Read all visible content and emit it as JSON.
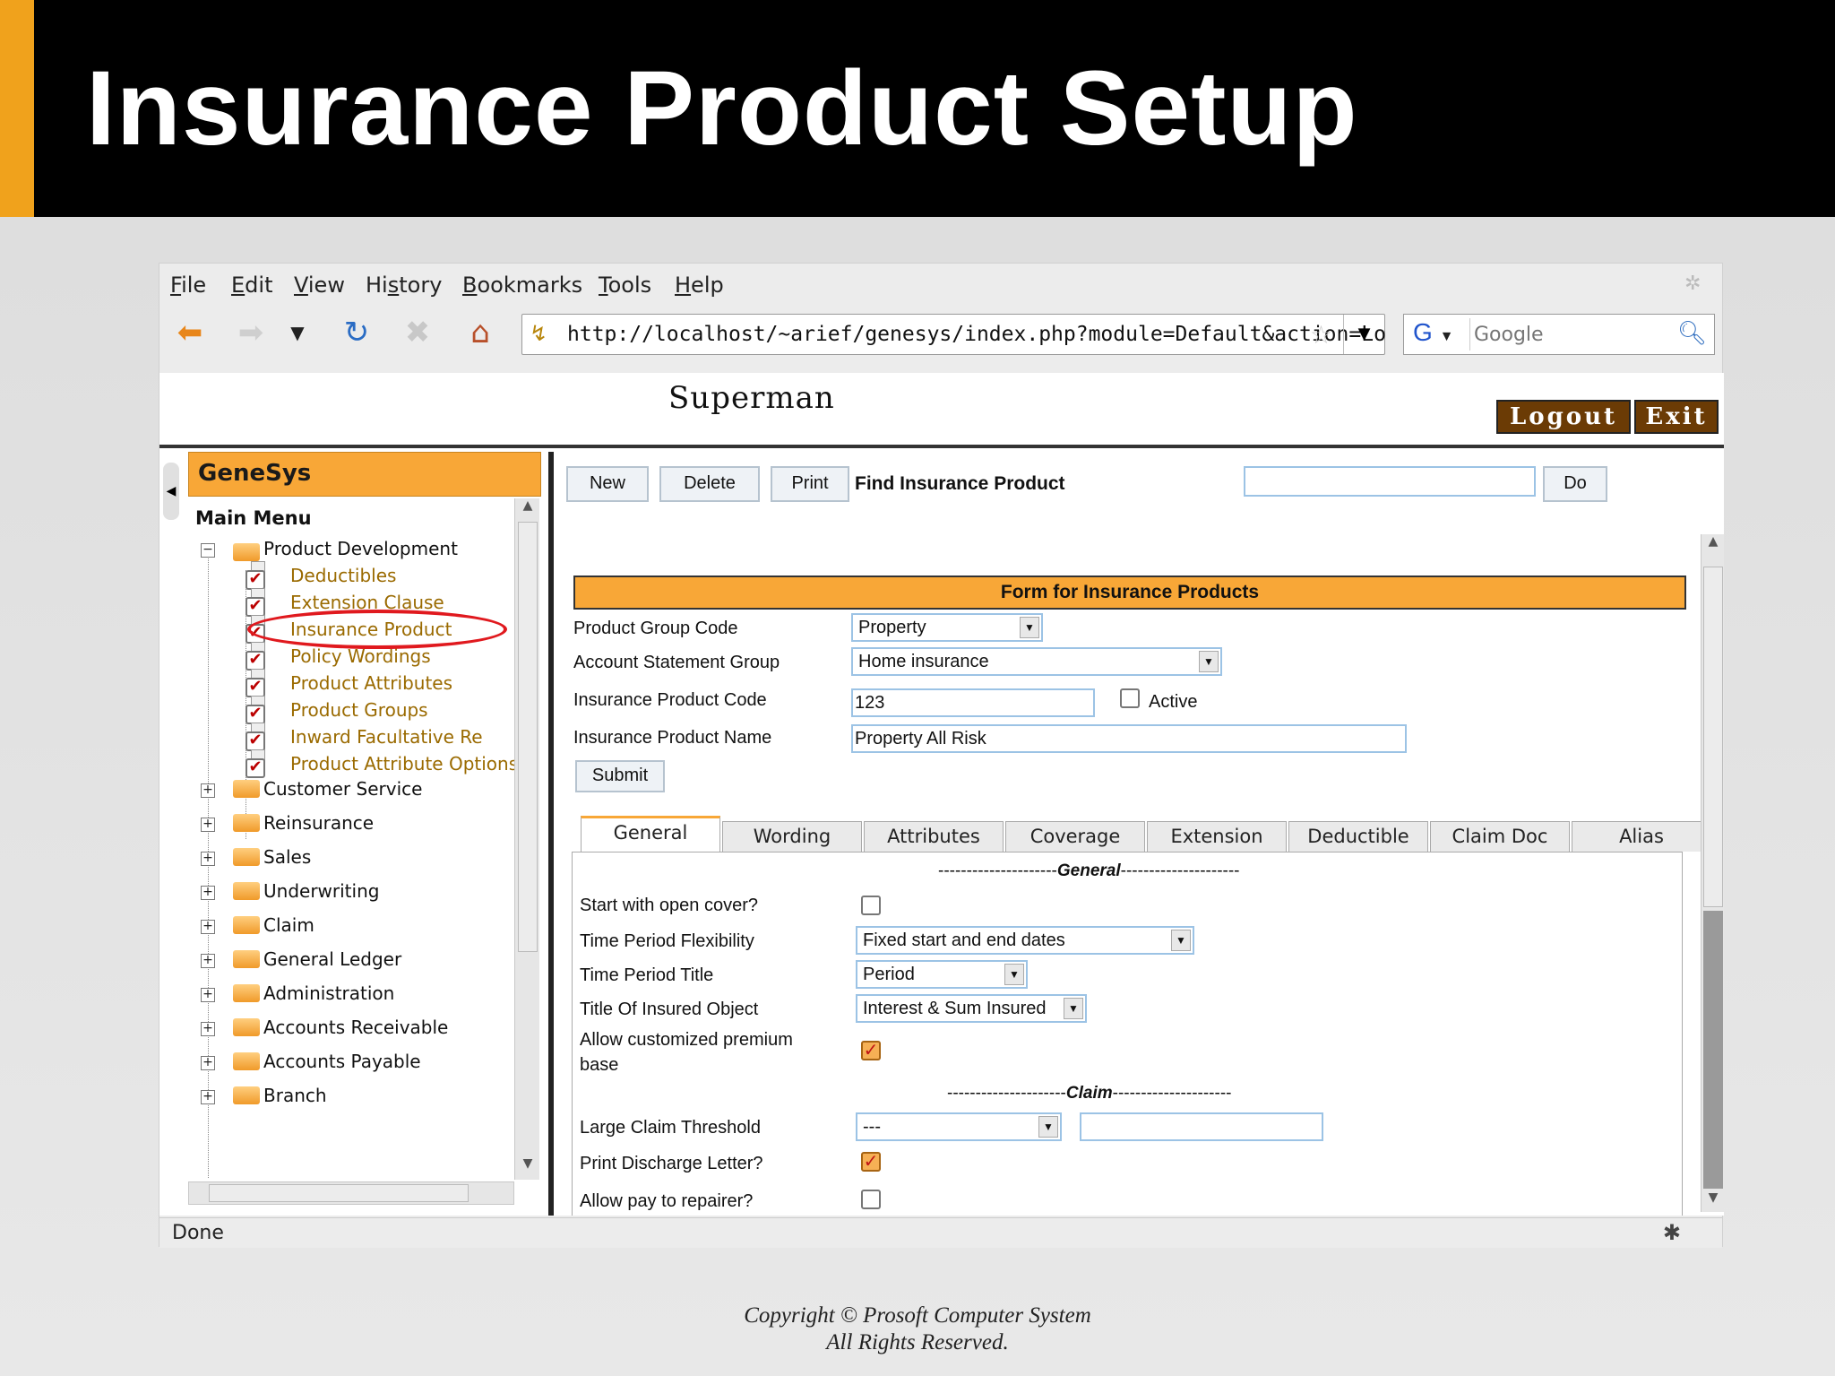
{
  "slide": {
    "title": "Insurance Product Setup",
    "footer_line1": "Copyright © Prosoft Computer System",
    "footer_line2": "All Rights Reserved."
  },
  "browser": {
    "menu": [
      "File",
      "Edit",
      "View",
      "History",
      "Bookmarks",
      "Tools",
      "Help"
    ],
    "menu_mnemonics": [
      "F",
      "E",
      "V",
      "s",
      "B",
      "T",
      "H"
    ],
    "url": "http://localhost/~arief/genesys/index.php?module=Default&action=Lo",
    "search_engine_icon": "G",
    "search_placeholder": "Google",
    "status": "Done",
    "icons": [
      "back-arrow-icon",
      "forward-arrow-icon",
      "history-dropdown-icon",
      "reload-icon",
      "stop-icon",
      "home-icon",
      "bookmark-star-icon",
      "search-magnifier-icon",
      "bug-icon"
    ]
  },
  "app": {
    "user_title": "Superman",
    "logout_label": "Logout",
    "exit_label": "Exit",
    "brand": "GeneSys",
    "menu_heading": "Main Menu",
    "tree": {
      "root": "Product Development",
      "children": [
        "Deductibles",
        "Extension Clause",
        "Insurance Product",
        "Policy Wordings",
        "Product Attributes",
        "Product Groups",
        "Inward Facultative Re",
        "Product Attribute Options"
      ],
      "highlighted": "Insurance Product",
      "folders": [
        "Customer Service",
        "Reinsurance",
        "Sales",
        "Underwriting",
        "Claim",
        "General Ledger",
        "Administration",
        "Accounts Receivable",
        "Accounts Payable",
        "Branch"
      ]
    },
    "toolbar": {
      "new_label": "New",
      "delete_label": "Delete",
      "print_label": "Print",
      "find_label": "Find Insurance Product",
      "find_value": "",
      "do_label": "Do"
    },
    "form": {
      "header": "Form for Insurance Products",
      "product_group_code_label": "Product Group Code",
      "product_group_code_value": "Property",
      "account_statement_group_label": "Account Statement Group",
      "account_statement_group_value": "Home insurance",
      "insurance_product_code_label": "Insurance Product Code",
      "insurance_product_code_value": "123",
      "active_label": "Active",
      "active_checked": false,
      "insurance_product_name_label": "Insurance Product Name",
      "insurance_product_name_value": "Property All Risk",
      "submit_label": "Submit"
    },
    "tabs": [
      "General",
      "Wording",
      "Attributes",
      "Coverage",
      "Extension",
      "Deductible",
      "Claim Doc",
      "Alias"
    ],
    "active_tab": "General",
    "general": {
      "section_general_prefix": "---------------------",
      "section_general_name": "General",
      "section_general_suffix": "---------------------",
      "start_open_cover_label": "Start with open cover?",
      "start_open_cover_checked": false,
      "time_period_flexibility_label": "Time Period Flexibility",
      "time_period_flexibility_value": "Fixed start and end dates",
      "time_period_title_label": "Time Period Title",
      "time_period_title_value": "Period",
      "title_insured_object_label": "Title Of Insured Object",
      "title_insured_object_value": "Interest & Sum Insured",
      "allow_custom_premium_label_1": "Allow customized premium",
      "allow_custom_premium_label_2": "base",
      "allow_custom_premium_checked": true,
      "section_claim_prefix": "---------------------",
      "section_claim_name": "Claim",
      "section_claim_suffix": "---------------------",
      "large_claim_threshold_label": "Large Claim Threshold",
      "large_claim_threshold_value": "---",
      "large_claim_threshold_amount": "",
      "print_discharge_letter_label": "Print Discharge Letter?",
      "print_discharge_letter_checked": true,
      "allow_pay_repairer_label": "Allow pay to repairer?",
      "allow_pay_repairer_checked": false
    }
  }
}
